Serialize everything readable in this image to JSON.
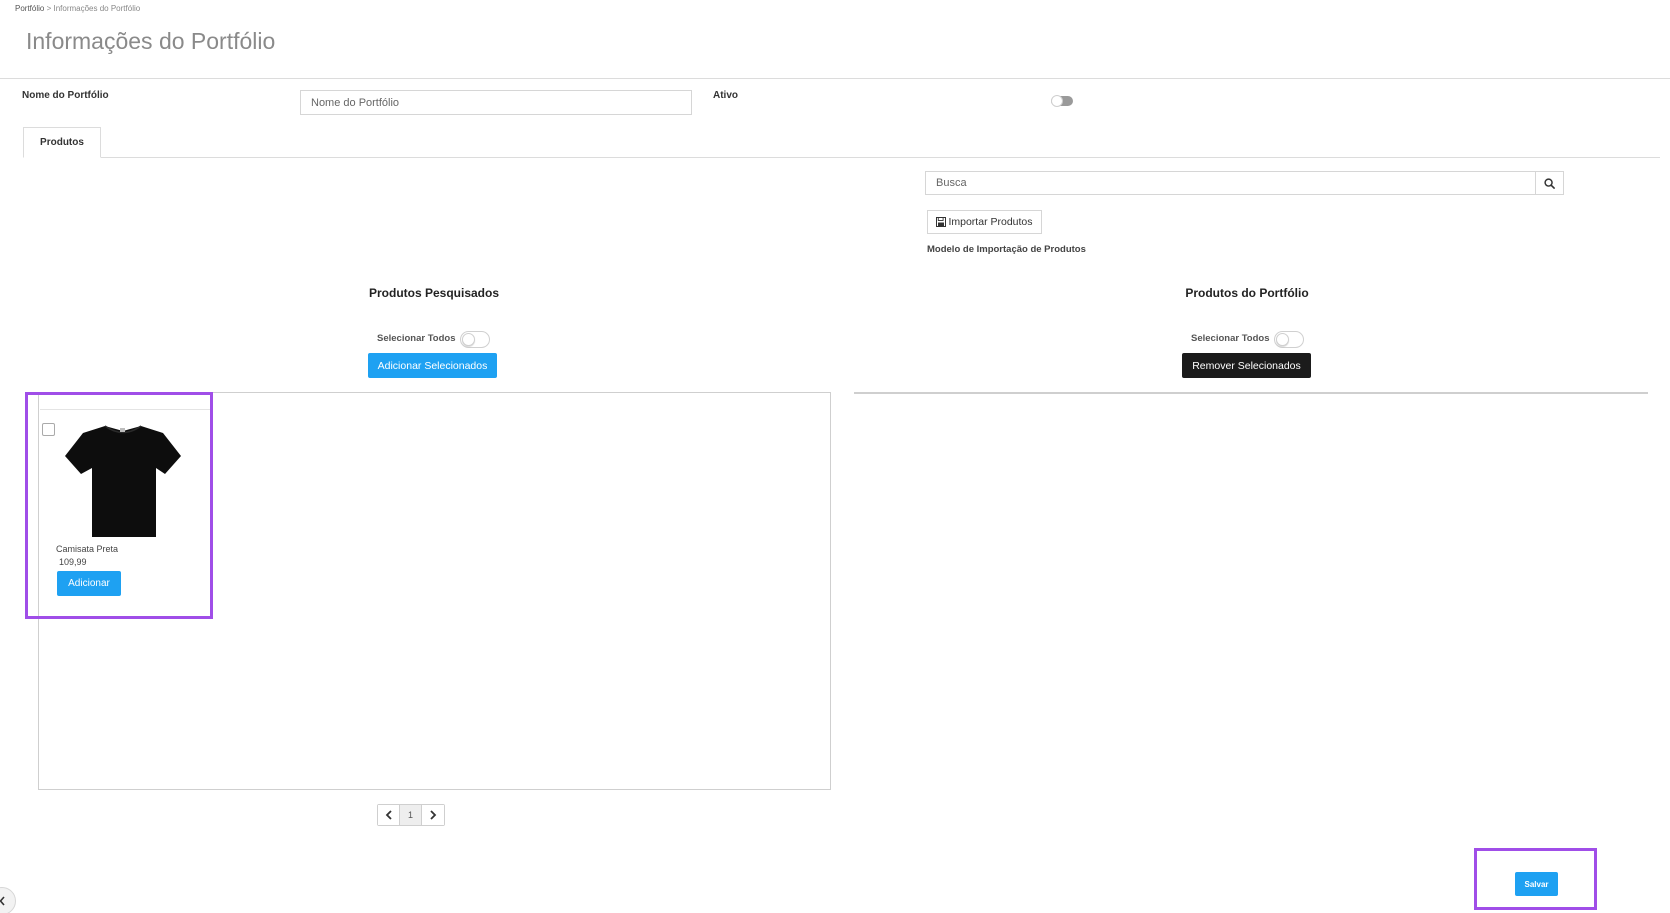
{
  "breadcrumb": {
    "root": "Portfólio",
    "separator": " > ",
    "current": "Informações do Portfólio"
  },
  "page_title": "Informações do Portfólio",
  "form": {
    "name_label": "Nome do Portfólio",
    "name_placeholder": "Nome do Portfólio",
    "active_label": "Ativo"
  },
  "tabs": [
    {
      "label": "Produtos"
    }
  ],
  "search": {
    "placeholder": "Busca",
    "icon": "search-icon"
  },
  "import": {
    "button_label": "Importar Produtos",
    "icon": "save-icon",
    "template_link": "Modelo de Importação de Produtos"
  },
  "searched_products": {
    "title": "Produtos Pesquisados",
    "select_all_label": "Selecionar Todos",
    "add_selected_label": "Adicionar Selecionados",
    "items": [
      {
        "name": "Camisata Preta",
        "price": "109,99",
        "add_label": "Adicionar",
        "image": "black-tshirt"
      }
    ],
    "pagination": {
      "current_page": "1"
    }
  },
  "portfolio_products": {
    "title": "Produtos do Portfólio",
    "select_all_label": "Selecionar Todos",
    "remove_selected_label": "Remover Selecionados"
  },
  "save_label": "Salvar",
  "colors": {
    "primary": "#1ea1f2",
    "dark": "#1b1b1b",
    "highlight": "#a04ee8"
  }
}
